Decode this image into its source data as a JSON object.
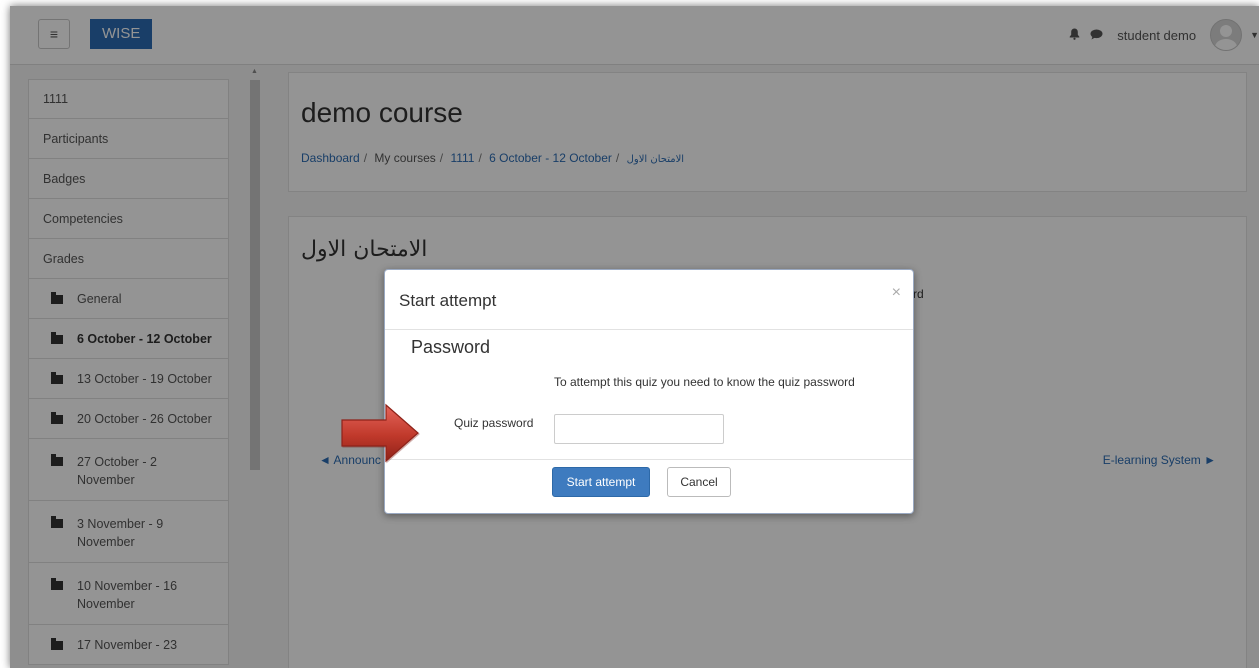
{
  "navbar": {
    "menu_icon": "hamburger-icon",
    "brand": "WISE",
    "notification_icon": "bell-icon",
    "messages_icon": "chat-bubble-icon",
    "user_name": "student demo",
    "avatar_icon": "user-avatar-icon",
    "dropdown_icon": "chevron-down-icon"
  },
  "sidebar": {
    "items": [
      {
        "label": "1111"
      },
      {
        "label": "Participants"
      },
      {
        "label": "Badges"
      },
      {
        "label": "Competencies"
      },
      {
        "label": "Grades"
      }
    ],
    "sections": [
      {
        "label": "General",
        "icon": "folder-icon"
      },
      {
        "label": "6 October - 12 October",
        "icon": "folder-icon",
        "active": true
      },
      {
        "label": "13 October - 19 October",
        "icon": "folder-icon"
      },
      {
        "label": "20 October - 26 October",
        "icon": "folder-icon"
      },
      {
        "label": "27 October - 2 November",
        "icon": "folder-icon"
      },
      {
        "label": "3 November - 9 November",
        "icon": "folder-icon"
      },
      {
        "label": "10 November - 16 November",
        "icon": "folder-icon"
      },
      {
        "label": "17 November - 23",
        "icon": "folder-icon"
      }
    ]
  },
  "header": {
    "course_title": "demo course",
    "breadcrumb": [
      {
        "label": "Dashboard",
        "link": true
      },
      {
        "label": "My courses",
        "link": false
      },
      {
        "label": "1111",
        "link": true
      },
      {
        "label": "6 October - 12 October",
        "link": true
      },
      {
        "label": "الامتحان الاول",
        "link": true
      }
    ]
  },
  "content": {
    "quiz_title": "الامتحان الاول",
    "behind_text_fragment": "rd",
    "prev_link": "◄ Announc",
    "next_link": "E-learning System ►"
  },
  "modal": {
    "title": "Start attempt",
    "close_glyph": "×",
    "section_title": "Password",
    "note": "To attempt this quiz you need to know the quiz password",
    "password_label": "Quiz password",
    "password_value": "",
    "start_button": "Start attempt",
    "cancel_button": "Cancel"
  },
  "annotation": {
    "arrow_color": "#c0392b",
    "arrow_icon": "red-arrow-right-icon"
  },
  "colors": {
    "brand": "#2b6cb3",
    "link": "#2b6cb3",
    "primary_button": "#3e7bbf"
  }
}
